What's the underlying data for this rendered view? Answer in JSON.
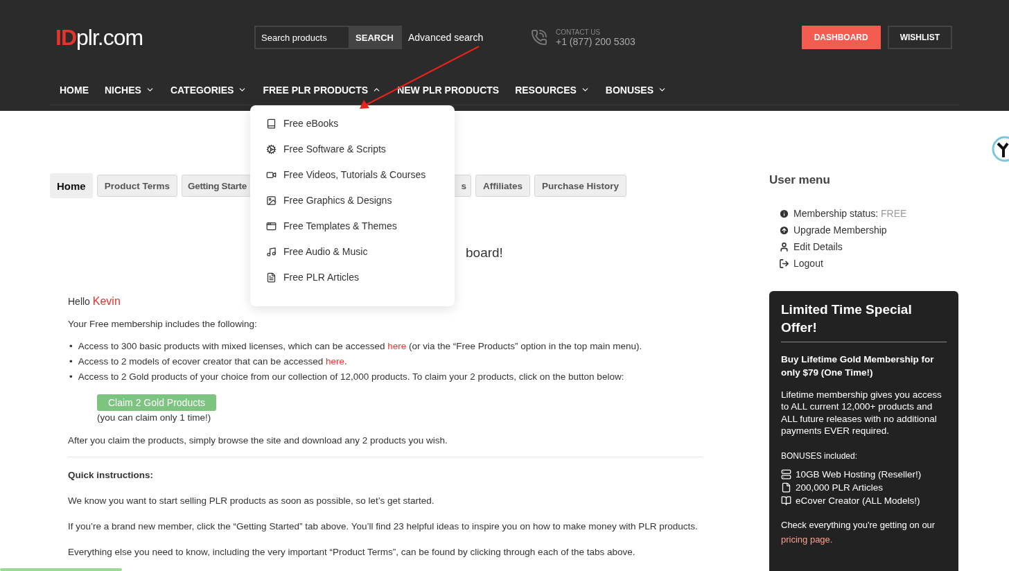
{
  "header": {
    "logo": {
      "mark": "ID",
      "name": "plr.com"
    },
    "search": {
      "placeholder": "Search products",
      "button": "SEARCH",
      "advanced": "Advanced search"
    },
    "contact": {
      "label": "CONTACT US",
      "phone": "+1 (877) 200 5303"
    },
    "buttons": [
      {
        "label": "DASHBOARD",
        "kind": "primary"
      },
      {
        "label": "WISHLIST",
        "kind": "outline"
      }
    ]
  },
  "nav": [
    {
      "label": "HOME",
      "kind": "link"
    },
    {
      "label": "NICHES",
      "kind": "menu",
      "expanded": false
    },
    {
      "label": "CATEGORIES",
      "kind": "menu",
      "expanded": false
    },
    {
      "label": "FREE PLR PRODUCTS",
      "kind": "menu",
      "expanded": true
    },
    {
      "label": "NEW PLR PRODUCTS",
      "kind": "link"
    },
    {
      "label": "RESOURCES",
      "kind": "menu",
      "expanded": false
    },
    {
      "label": "BONUSES",
      "kind": "menu",
      "expanded": false
    }
  ],
  "dropdown": [
    "Free eBooks",
    "Free Software & Scripts",
    "Free Videos, Tutorials & Courses",
    "Free Graphics & Designs",
    "Free Templates & Themes",
    "Free Audio & Music",
    "Free PLR Articles"
  ],
  "tabs": [
    {
      "label": "Home",
      "selected": true,
      "kind": "full"
    },
    {
      "label": "Product Terms",
      "selected": false,
      "kind": "full"
    },
    {
      "label": "Getting Starte",
      "selected": false,
      "kind": "cut_right"
    },
    {
      "label": "s",
      "selected": false,
      "kind": "cut_left"
    },
    {
      "label": "Affiliates",
      "selected": false,
      "kind": "full"
    },
    {
      "label": "Purchase History",
      "selected": false,
      "kind": "full"
    }
  ],
  "main": {
    "heading": "board!",
    "greeting": "Hello",
    "user": "Kevin",
    "intro": "Your Free membership includes the following:",
    "marker": "•",
    "bullets": [
      {
        "before": "Access to 300 basic products with mixed licenses, which can be accessed ",
        "link": "here",
        "after": " (or via the “Free Products” option in the top main menu)."
      },
      {
        "before": "Access to 2 models of ecover creator that can be accessed ",
        "link": "here",
        "after": "."
      },
      {
        "before": "Access to 2 Gold products of your choice from our collection of 12,000 products. To claim your 2 products, click on the button below:"
      }
    ],
    "claim_button": "Claim 2 Gold Products",
    "claim_note": "(you can claim only 1 time!)",
    "after_claim": "After you claim the products, simply browse the site and download any 2 products you wish.",
    "instructions_title": "Quick instructions:",
    "paragraphs": [
      "We know you want to start selling PLR products as soon as possible, so let’s get started.",
      "If you’re a brand new member, click the “Getting Started” tab above. You’ll find 23 helpful ideas to inspire you on how to make money with PLR products.",
      "Everything else you need to know, including the very important “Product Terms”, can be found by clicking through each of the tabs above."
    ]
  },
  "sidebar": {
    "title": "User menu",
    "items": [
      {
        "label": "Membership status:",
        "value": "FREE"
      },
      {
        "label": "Upgrade Membership"
      },
      {
        "label": "Edit Details"
      },
      {
        "label": "Logout"
      }
    ],
    "offer": {
      "title": "Limited Time Special Offer!",
      "subtitle": "Buy Lifetime Gold Membership for only $79 (One Time!)",
      "body": "Lifetime membership gives you access to ALL current 12,000+ products and ALL future releases with no additional payments EVER required.",
      "bonuses_label": "BONUSES included:",
      "bonuses": [
        "10GB Web Hosting (Reseller!)",
        "200,000 PLR Articles",
        "eCover Creator (ALL Models!)"
      ],
      "footer": "Check everything you're getting on our",
      "footer_link": "pricing page."
    }
  }
}
